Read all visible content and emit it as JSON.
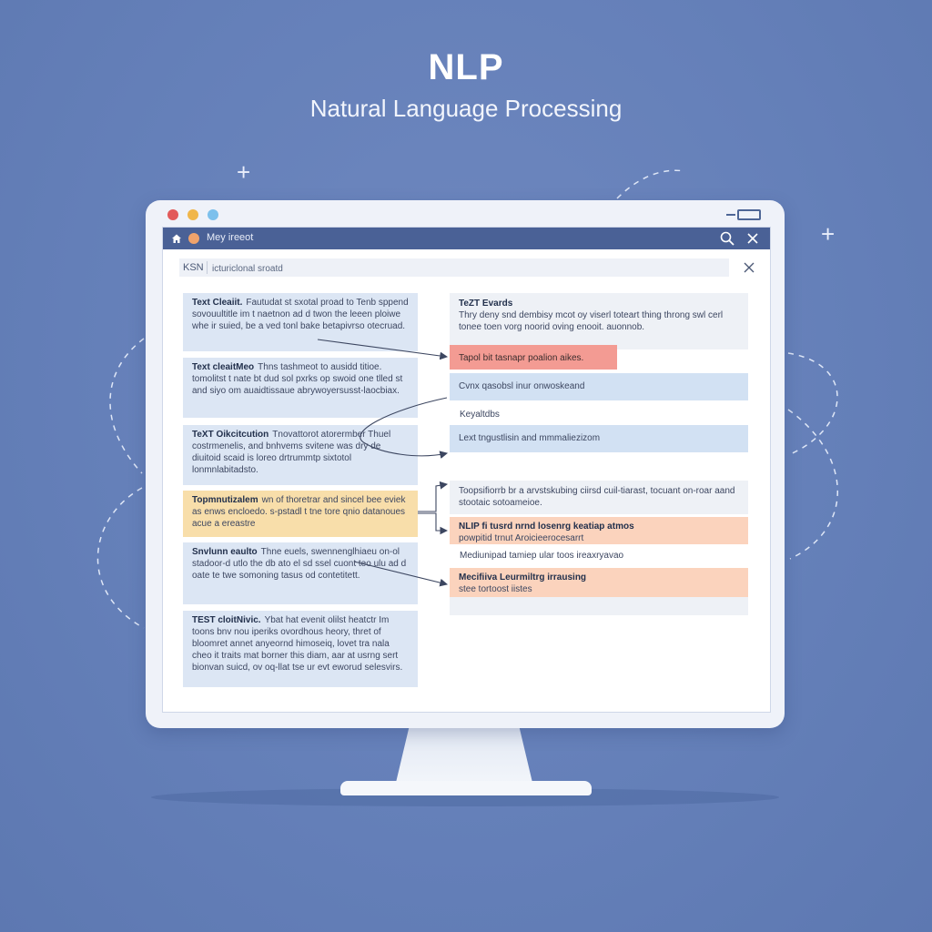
{
  "hero": {
    "title": "NLP",
    "subtitle": "Natural Language Processing"
  },
  "colors": {
    "background": "#6580b9",
    "titlebar": "#4a6196",
    "card_blue": "#dce6f4",
    "card_yellow": "#f8deaa",
    "box_coral": "#f39b93",
    "box_peach": "#fbd3bd",
    "box_blue": "#d2e1f3"
  },
  "icons": [
    "home-icon",
    "search-icon",
    "close-icon",
    "sparkle-icon"
  ],
  "window": {
    "title": "Mey ireeot",
    "search": {
      "prefix": "KSN",
      "value": "icturiclonal sroatd"
    }
  },
  "left_cards": [
    {
      "heading": "Text Cleaiit.",
      "body": "Fautudat st sxotal proad to Tenb sppend sovouultitle im t naetnon ad d twon the leeen ploiwe whe ir suied, be a ved tonl bake betapivrso otecruad."
    },
    {
      "heading": "Text cleaitMeo",
      "body": "Thns tashmeot to ausidd titioe. tomolitst t nate bt dud sol pxrks op swoid one tlled st and siyo om auaidtissaue abrywoyersusst-laocbiax."
    },
    {
      "heading": "TeXT Oikcitcution",
      "body": "Tnovattorot atorermber Thuel costrmenelis, and bnhvems svitene was dry de diuitoid scaid is loreo drtrummtp sixtotol lonmnlabitadsto."
    },
    {
      "heading": "Topmnutizalem",
      "body": "wn of thoretrar and sincel bee eviek as enws encloedo. s-pstadl t tne tore qnio datanoues acue a ereastre"
    },
    {
      "heading": "Snvlunn eaulto",
      "body": "Thne euels, swennenglhiaeu on-ol stadoor-d utlo the db ato el sd ssel cuont teo ulu ad d oate te twe somoning tasus od contetitett."
    },
    {
      "heading": "TEST cloitNivic.",
      "body": "Ybat hat evenit olilst heatctr Im toons bnv nou iperiks ovordhous heory, thret of bloomret annet anyeornd himoseiq, lovet tra nala cheo it traits mat borner this diam, aar at usrng sert bionvan suicd, ov oq-llat tse ur evt eworud selesvirs."
    }
  ],
  "right_panel": {
    "box1": {
      "heading": "TeZT Evards",
      "body": "Thry deny snd dembisy mcot oy viserl toteart thing throng swl cerl tonee toen vorg noorid oving enooit. auonnob."
    },
    "box2": "Tapol bit tasnapr poalion aikes.",
    "box3": "Cvnx qasobsl inur onwoskeand",
    "label1": "Keyaltdbs",
    "box4": "Lext tngustlisin and mmmaliezizom",
    "box5": "Toopsifiorrb br a arvstskubing ciirsd cuil-tiarast, tocuant on-roar aand stootaic sotoameioe.",
    "box6_heading": "NLIP fi tusrd nrnd losenrg keatiap atmos",
    "box6_body": "powpitid trnut Aroicieerocesarrt",
    "label2": "Mediunipad tamiep ular toos ireaxryavao",
    "box7_heading": "Mecifiiva Leurmiltrg irrausing",
    "box7_body": "stee tortoost iistes"
  }
}
